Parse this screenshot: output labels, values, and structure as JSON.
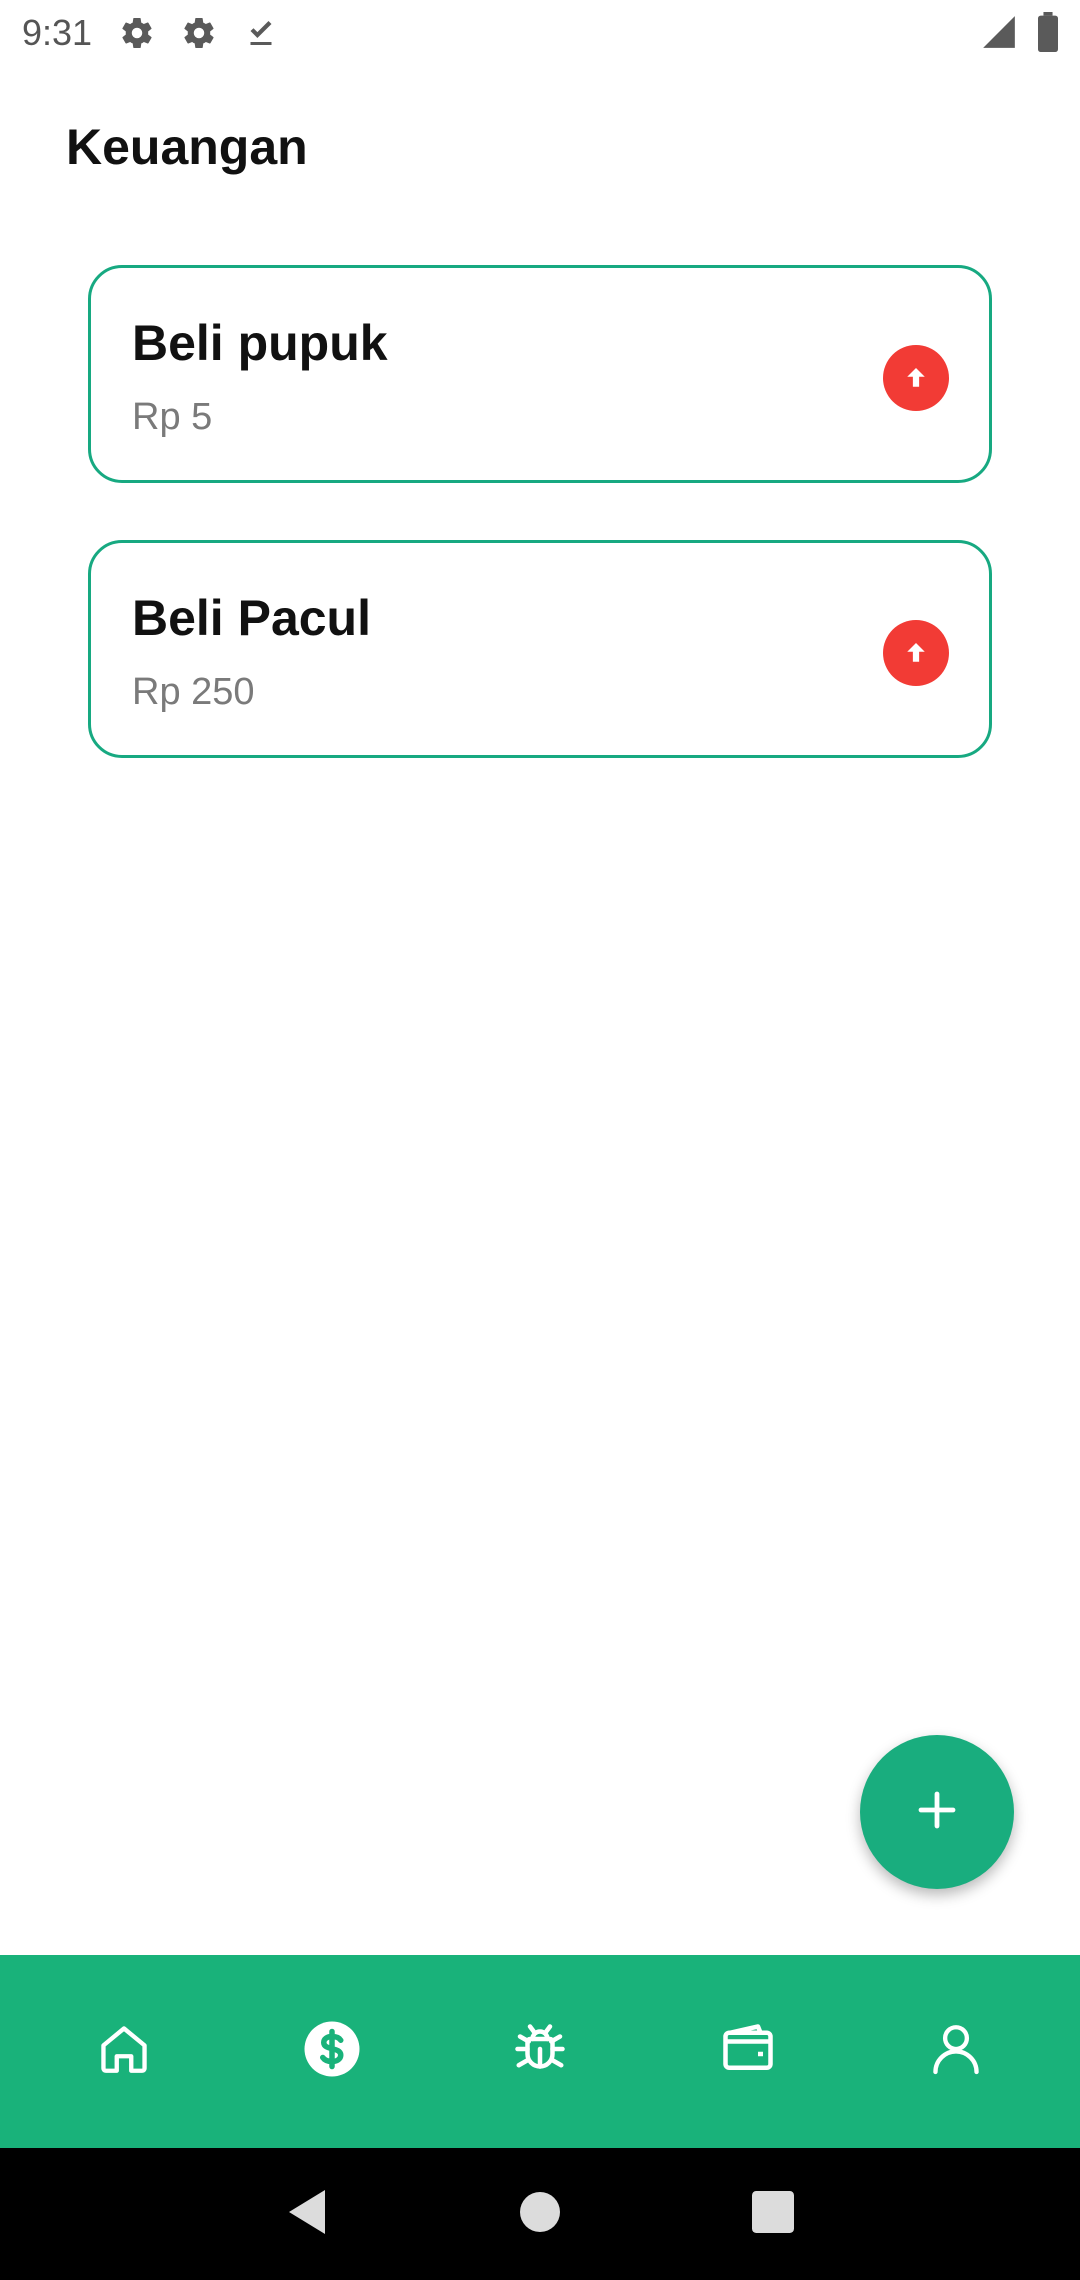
{
  "status_bar": {
    "time": "9:31",
    "icons_left": [
      "gear-icon",
      "gear-icon",
      "download-done-icon"
    ],
    "icons_right": [
      "signal-icon",
      "battery-icon"
    ]
  },
  "page": {
    "title": "Keuangan"
  },
  "transactions": [
    {
      "title": "Beli pupuk",
      "amount": "Rp 5",
      "type_icon": "arrow-up-icon",
      "badge_color": "#f23b35"
    },
    {
      "title": "Beli Pacul",
      "amount": "Rp 250",
      "type_icon": "arrow-up-icon",
      "badge_color": "#f23b35"
    }
  ],
  "fab": {
    "icon": "plus-icon"
  },
  "bottom_nav": {
    "items": [
      {
        "name": "home",
        "icon": "home-icon"
      },
      {
        "name": "finance",
        "icon": "dollar-circle-icon",
        "active": true
      },
      {
        "name": "pests",
        "icon": "bug-icon"
      },
      {
        "name": "wallet",
        "icon": "wallet-icon"
      },
      {
        "name": "profile",
        "icon": "user-icon"
      }
    ],
    "background": "#19b27a"
  },
  "colors": {
    "accent": "#19ad7e",
    "card_border": "#17a981",
    "expense": "#f23b35"
  }
}
